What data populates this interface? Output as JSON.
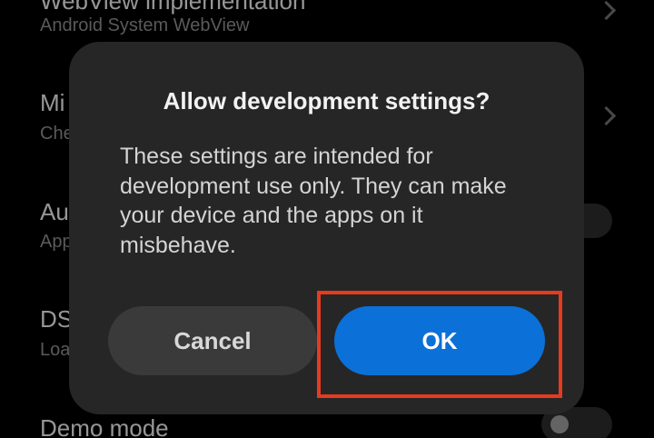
{
  "background_list": {
    "items": [
      {
        "title": "WebView implementation",
        "subtitle": "Android System WebView"
      },
      {
        "title": "Mi",
        "subtitle": "Che"
      },
      {
        "title": "Au",
        "subtitle": "App"
      },
      {
        "title": "DS",
        "subtitle": "Loa"
      },
      {
        "title": "Demo mode",
        "subtitle": ""
      }
    ]
  },
  "dialog": {
    "title": "Allow development settings?",
    "message": "These settings are intended for development use only. They can make your device and the apps on it misbehave.",
    "cancel_label": "Cancel",
    "ok_label": "OK"
  },
  "colors": {
    "dialog_bg": "#262626",
    "ok_button": "#0b71d8",
    "cancel_button": "#3a3a3a",
    "highlight": "#e63b1e"
  }
}
